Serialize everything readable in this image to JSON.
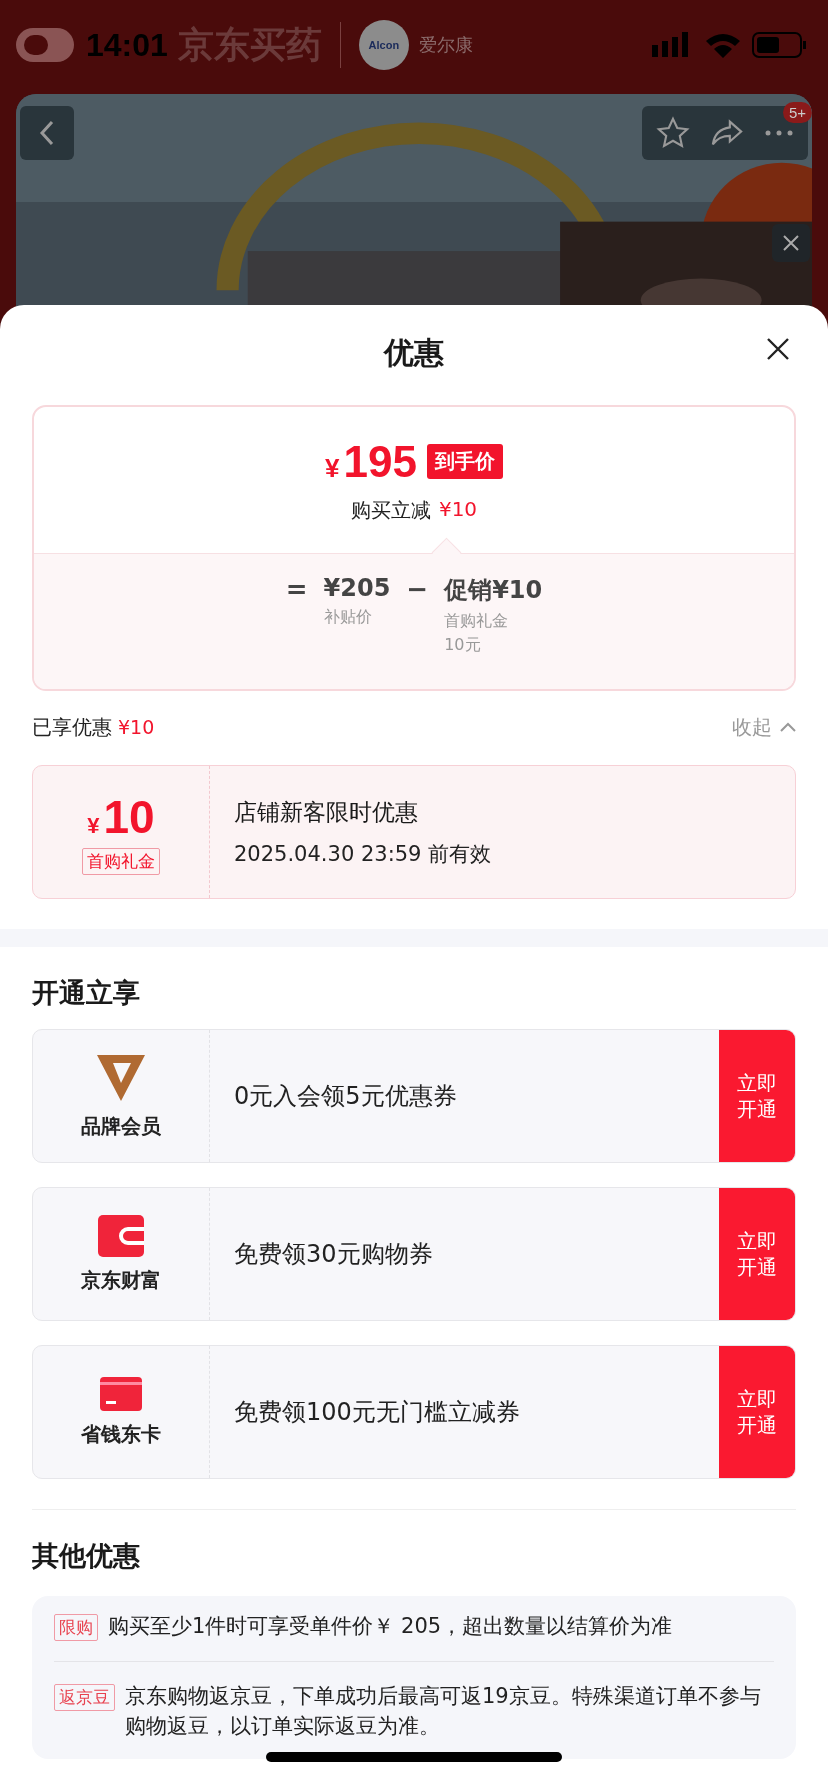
{
  "status_bar": {
    "time": "14:01"
  },
  "header": {
    "logo_text": "京东买药",
    "brand_badge": "Alcon",
    "brand_name": "爱尔康",
    "badge": "5+"
  },
  "sheet": {
    "title": "优惠",
    "price_card": {
      "currency": "¥",
      "price": "195",
      "tag": "到手价",
      "subtitle": "购买立减",
      "subtitle_amount": "¥10",
      "formula": [
        {
          "kind": "op",
          "text": "="
        },
        {
          "kind": "term",
          "value": "¥205",
          "labels": [
            "补贴价"
          ]
        },
        {
          "kind": "op",
          "text": "−"
        },
        {
          "kind": "term",
          "value": "促销¥10",
          "labels": [
            "首购礼金",
            "10元"
          ]
        }
      ]
    },
    "enjoyed": {
      "label": "已享优惠",
      "amount": "¥10",
      "toggle": "收起",
      "expanded": true
    },
    "coupons": [
      {
        "currency": "¥",
        "amount": "10",
        "tag": "首购礼金",
        "title": "店铺新客限时优惠",
        "validity": "2025.04.30 23:59 前有效"
      }
    ],
    "open_section": {
      "title": "开通立享",
      "items": [
        {
          "kind": "vip",
          "name": "品牌会员",
          "text": "0元入会领5元优惠券",
          "button": [
            "立即",
            "开通"
          ]
        },
        {
          "kind": "wallet",
          "name": "京东财富",
          "text": "免费领30元购物券",
          "button": [
            "立即",
            "开通"
          ]
        },
        {
          "kind": "card",
          "name": "省钱东卡",
          "text": "免费领100元无门槛立减券",
          "button": [
            "立即",
            "开通"
          ]
        }
      ]
    },
    "other_section": {
      "title": "其他优惠",
      "items": [
        {
          "tag": "限购",
          "text": "购买至少1件时可享受单件价￥ 205，超出数量以结算价为准"
        },
        {
          "tag": "返京豆",
          "text": "京东购物返京豆，下单成功后最高可返19京豆。特殊渠道订单不参与购物返豆，以订单实际返豆为准。"
        }
      ]
    }
  }
}
